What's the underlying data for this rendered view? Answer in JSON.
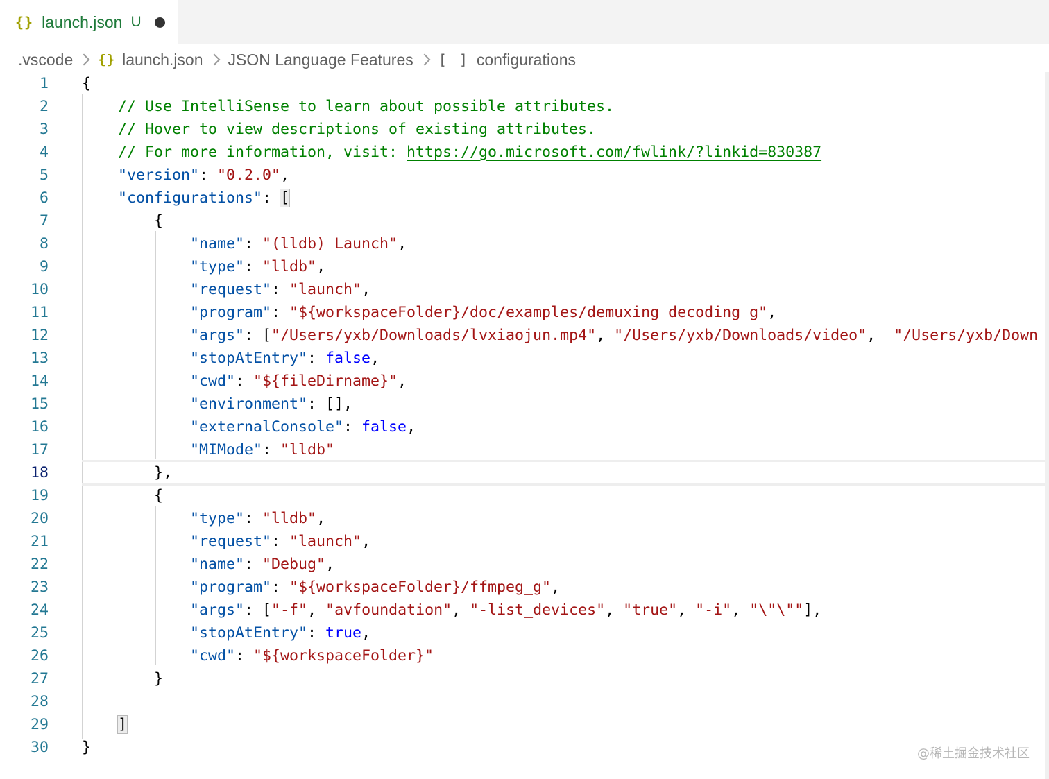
{
  "tab": {
    "icon": "{}",
    "filename": "launch.json",
    "status": "U"
  },
  "breadcrumb": {
    "folder": ".vscode",
    "file_icon": "{}",
    "file": "launch.json",
    "language": "JSON Language Features",
    "symbol_icon": "[ ]",
    "symbol": "configurations"
  },
  "editor": {
    "current_line": 18,
    "lines": [
      {
        "n": "1",
        "tokens": [
          {
            "t": "{",
            "c": "punc"
          }
        ]
      },
      {
        "n": "2",
        "tokens": [
          {
            "t": "    ",
            "c": "punc"
          },
          {
            "t": "// Use IntelliSense to learn about possible attributes.",
            "c": "comment"
          }
        ]
      },
      {
        "n": "3",
        "tokens": [
          {
            "t": "    ",
            "c": "punc"
          },
          {
            "t": "// Hover to view descriptions of existing attributes.",
            "c": "comment"
          }
        ]
      },
      {
        "n": "4",
        "tokens": [
          {
            "t": "    ",
            "c": "punc"
          },
          {
            "t": "// For more information, visit: ",
            "c": "comment"
          },
          {
            "t": "https://go.microsoft.com/fwlink/?linkid=830387",
            "c": "link"
          }
        ]
      },
      {
        "n": "5",
        "tokens": [
          {
            "t": "    ",
            "c": "punc"
          },
          {
            "t": "\"version\"",
            "c": "key"
          },
          {
            "t": ": ",
            "c": "punc"
          },
          {
            "t": "\"0.2.0\"",
            "c": "str"
          },
          {
            "t": ",",
            "c": "punc"
          }
        ]
      },
      {
        "n": "6",
        "tokens": [
          {
            "t": "    ",
            "c": "punc"
          },
          {
            "t": "\"configurations\"",
            "c": "key"
          },
          {
            "t": ": ",
            "c": "punc"
          },
          {
            "t": "[",
            "c": "match"
          }
        ]
      },
      {
        "n": "7",
        "tokens": [
          {
            "t": "        {",
            "c": "punc"
          }
        ]
      },
      {
        "n": "8",
        "tokens": [
          {
            "t": "            ",
            "c": "punc"
          },
          {
            "t": "\"name\"",
            "c": "key"
          },
          {
            "t": ": ",
            "c": "punc"
          },
          {
            "t": "\"(lldb) Launch\"",
            "c": "str"
          },
          {
            "t": ",",
            "c": "punc"
          }
        ]
      },
      {
        "n": "9",
        "tokens": [
          {
            "t": "            ",
            "c": "punc"
          },
          {
            "t": "\"type\"",
            "c": "key"
          },
          {
            "t": ": ",
            "c": "punc"
          },
          {
            "t": "\"lldb\"",
            "c": "str"
          },
          {
            "t": ",",
            "c": "punc"
          }
        ]
      },
      {
        "n": "10",
        "tokens": [
          {
            "t": "            ",
            "c": "punc"
          },
          {
            "t": "\"request\"",
            "c": "key"
          },
          {
            "t": ": ",
            "c": "punc"
          },
          {
            "t": "\"launch\"",
            "c": "str"
          },
          {
            "t": ",",
            "c": "punc"
          }
        ]
      },
      {
        "n": "11",
        "tokens": [
          {
            "t": "            ",
            "c": "punc"
          },
          {
            "t": "\"program\"",
            "c": "key"
          },
          {
            "t": ": ",
            "c": "punc"
          },
          {
            "t": "\"${workspaceFolder}/doc/examples/demuxing_decoding_g\"",
            "c": "str"
          },
          {
            "t": ",",
            "c": "punc"
          }
        ]
      },
      {
        "n": "12",
        "tokens": [
          {
            "t": "            ",
            "c": "punc"
          },
          {
            "t": "\"args\"",
            "c": "key"
          },
          {
            "t": ": [",
            "c": "punc"
          },
          {
            "t": "\"/Users/yxb/Downloads/lvxiaojun.mp4\"",
            "c": "str"
          },
          {
            "t": ", ",
            "c": "punc"
          },
          {
            "t": "\"/Users/yxb/Downloads/video\"",
            "c": "str"
          },
          {
            "t": ",  ",
            "c": "punc"
          },
          {
            "t": "\"/Users/yxb/Down",
            "c": "str"
          }
        ]
      },
      {
        "n": "13",
        "tokens": [
          {
            "t": "            ",
            "c": "punc"
          },
          {
            "t": "\"stopAtEntry\"",
            "c": "key"
          },
          {
            "t": ": ",
            "c": "punc"
          },
          {
            "t": "false",
            "c": "bool"
          },
          {
            "t": ",",
            "c": "punc"
          }
        ]
      },
      {
        "n": "14",
        "tokens": [
          {
            "t": "            ",
            "c": "punc"
          },
          {
            "t": "\"cwd\"",
            "c": "key"
          },
          {
            "t": ": ",
            "c": "punc"
          },
          {
            "t": "\"${fileDirname}\"",
            "c": "str"
          },
          {
            "t": ",",
            "c": "punc"
          }
        ]
      },
      {
        "n": "15",
        "tokens": [
          {
            "t": "            ",
            "c": "punc"
          },
          {
            "t": "\"environment\"",
            "c": "key"
          },
          {
            "t": ": [],",
            "c": "punc"
          }
        ]
      },
      {
        "n": "16",
        "tokens": [
          {
            "t": "            ",
            "c": "punc"
          },
          {
            "t": "\"externalConsole\"",
            "c": "key"
          },
          {
            "t": ": ",
            "c": "punc"
          },
          {
            "t": "false",
            "c": "bool"
          },
          {
            "t": ",",
            "c": "punc"
          }
        ]
      },
      {
        "n": "17",
        "tokens": [
          {
            "t": "            ",
            "c": "punc"
          },
          {
            "t": "\"MIMode\"",
            "c": "key"
          },
          {
            "t": ": ",
            "c": "punc"
          },
          {
            "t": "\"lldb\"",
            "c": "str"
          }
        ]
      },
      {
        "n": "18",
        "tokens": [
          {
            "t": "        },",
            "c": "punc"
          }
        ]
      },
      {
        "n": "19",
        "tokens": [
          {
            "t": "        {",
            "c": "punc"
          }
        ]
      },
      {
        "n": "20",
        "tokens": [
          {
            "t": "            ",
            "c": "punc"
          },
          {
            "t": "\"type\"",
            "c": "key"
          },
          {
            "t": ": ",
            "c": "punc"
          },
          {
            "t": "\"lldb\"",
            "c": "str"
          },
          {
            "t": ",",
            "c": "punc"
          }
        ]
      },
      {
        "n": "21",
        "tokens": [
          {
            "t": "            ",
            "c": "punc"
          },
          {
            "t": "\"request\"",
            "c": "key"
          },
          {
            "t": ": ",
            "c": "punc"
          },
          {
            "t": "\"launch\"",
            "c": "str"
          },
          {
            "t": ",",
            "c": "punc"
          }
        ]
      },
      {
        "n": "22",
        "tokens": [
          {
            "t": "            ",
            "c": "punc"
          },
          {
            "t": "\"name\"",
            "c": "key"
          },
          {
            "t": ": ",
            "c": "punc"
          },
          {
            "t": "\"Debug\"",
            "c": "str"
          },
          {
            "t": ",",
            "c": "punc"
          }
        ]
      },
      {
        "n": "23",
        "tokens": [
          {
            "t": "            ",
            "c": "punc"
          },
          {
            "t": "\"program\"",
            "c": "key"
          },
          {
            "t": ": ",
            "c": "punc"
          },
          {
            "t": "\"${workspaceFolder}/ffmpeg_g\"",
            "c": "str"
          },
          {
            "t": ",",
            "c": "punc"
          }
        ]
      },
      {
        "n": "24",
        "tokens": [
          {
            "t": "            ",
            "c": "punc"
          },
          {
            "t": "\"args\"",
            "c": "key"
          },
          {
            "t": ": [",
            "c": "punc"
          },
          {
            "t": "\"-f\"",
            "c": "str"
          },
          {
            "t": ", ",
            "c": "punc"
          },
          {
            "t": "\"avfoundation\"",
            "c": "str"
          },
          {
            "t": ", ",
            "c": "punc"
          },
          {
            "t": "\"-list_devices\"",
            "c": "str"
          },
          {
            "t": ", ",
            "c": "punc"
          },
          {
            "t": "\"true\"",
            "c": "str"
          },
          {
            "t": ", ",
            "c": "punc"
          },
          {
            "t": "\"-i\"",
            "c": "str"
          },
          {
            "t": ", ",
            "c": "punc"
          },
          {
            "t": "\"\\\"\\\"\"",
            "c": "str"
          },
          {
            "t": "],",
            "c": "punc"
          }
        ]
      },
      {
        "n": "25",
        "tokens": [
          {
            "t": "            ",
            "c": "punc"
          },
          {
            "t": "\"stopAtEntry\"",
            "c": "key"
          },
          {
            "t": ": ",
            "c": "punc"
          },
          {
            "t": "true",
            "c": "bool"
          },
          {
            "t": ",",
            "c": "punc"
          }
        ]
      },
      {
        "n": "26",
        "tokens": [
          {
            "t": "            ",
            "c": "punc"
          },
          {
            "t": "\"cwd\"",
            "c": "key"
          },
          {
            "t": ": ",
            "c": "punc"
          },
          {
            "t": "\"${workspaceFolder}\"",
            "c": "str"
          }
        ]
      },
      {
        "n": "27",
        "tokens": [
          {
            "t": "        }",
            "c": "punc"
          }
        ]
      },
      {
        "n": "28",
        "tokens": []
      },
      {
        "n": "29",
        "tokens": [
          {
            "t": "    ",
            "c": "punc"
          },
          {
            "t": "]",
            "c": "match"
          }
        ]
      },
      {
        "n": "30",
        "tokens": [
          {
            "t": "}",
            "c": "punc"
          }
        ]
      }
    ]
  },
  "watermark": "@稀土掘金技术社区",
  "colors": {
    "comment": "#008000",
    "key": "#0451a5",
    "string": "#a31515",
    "boolean": "#0000ff",
    "line_number": "#237893",
    "line_number_active": "#0b216f"
  }
}
